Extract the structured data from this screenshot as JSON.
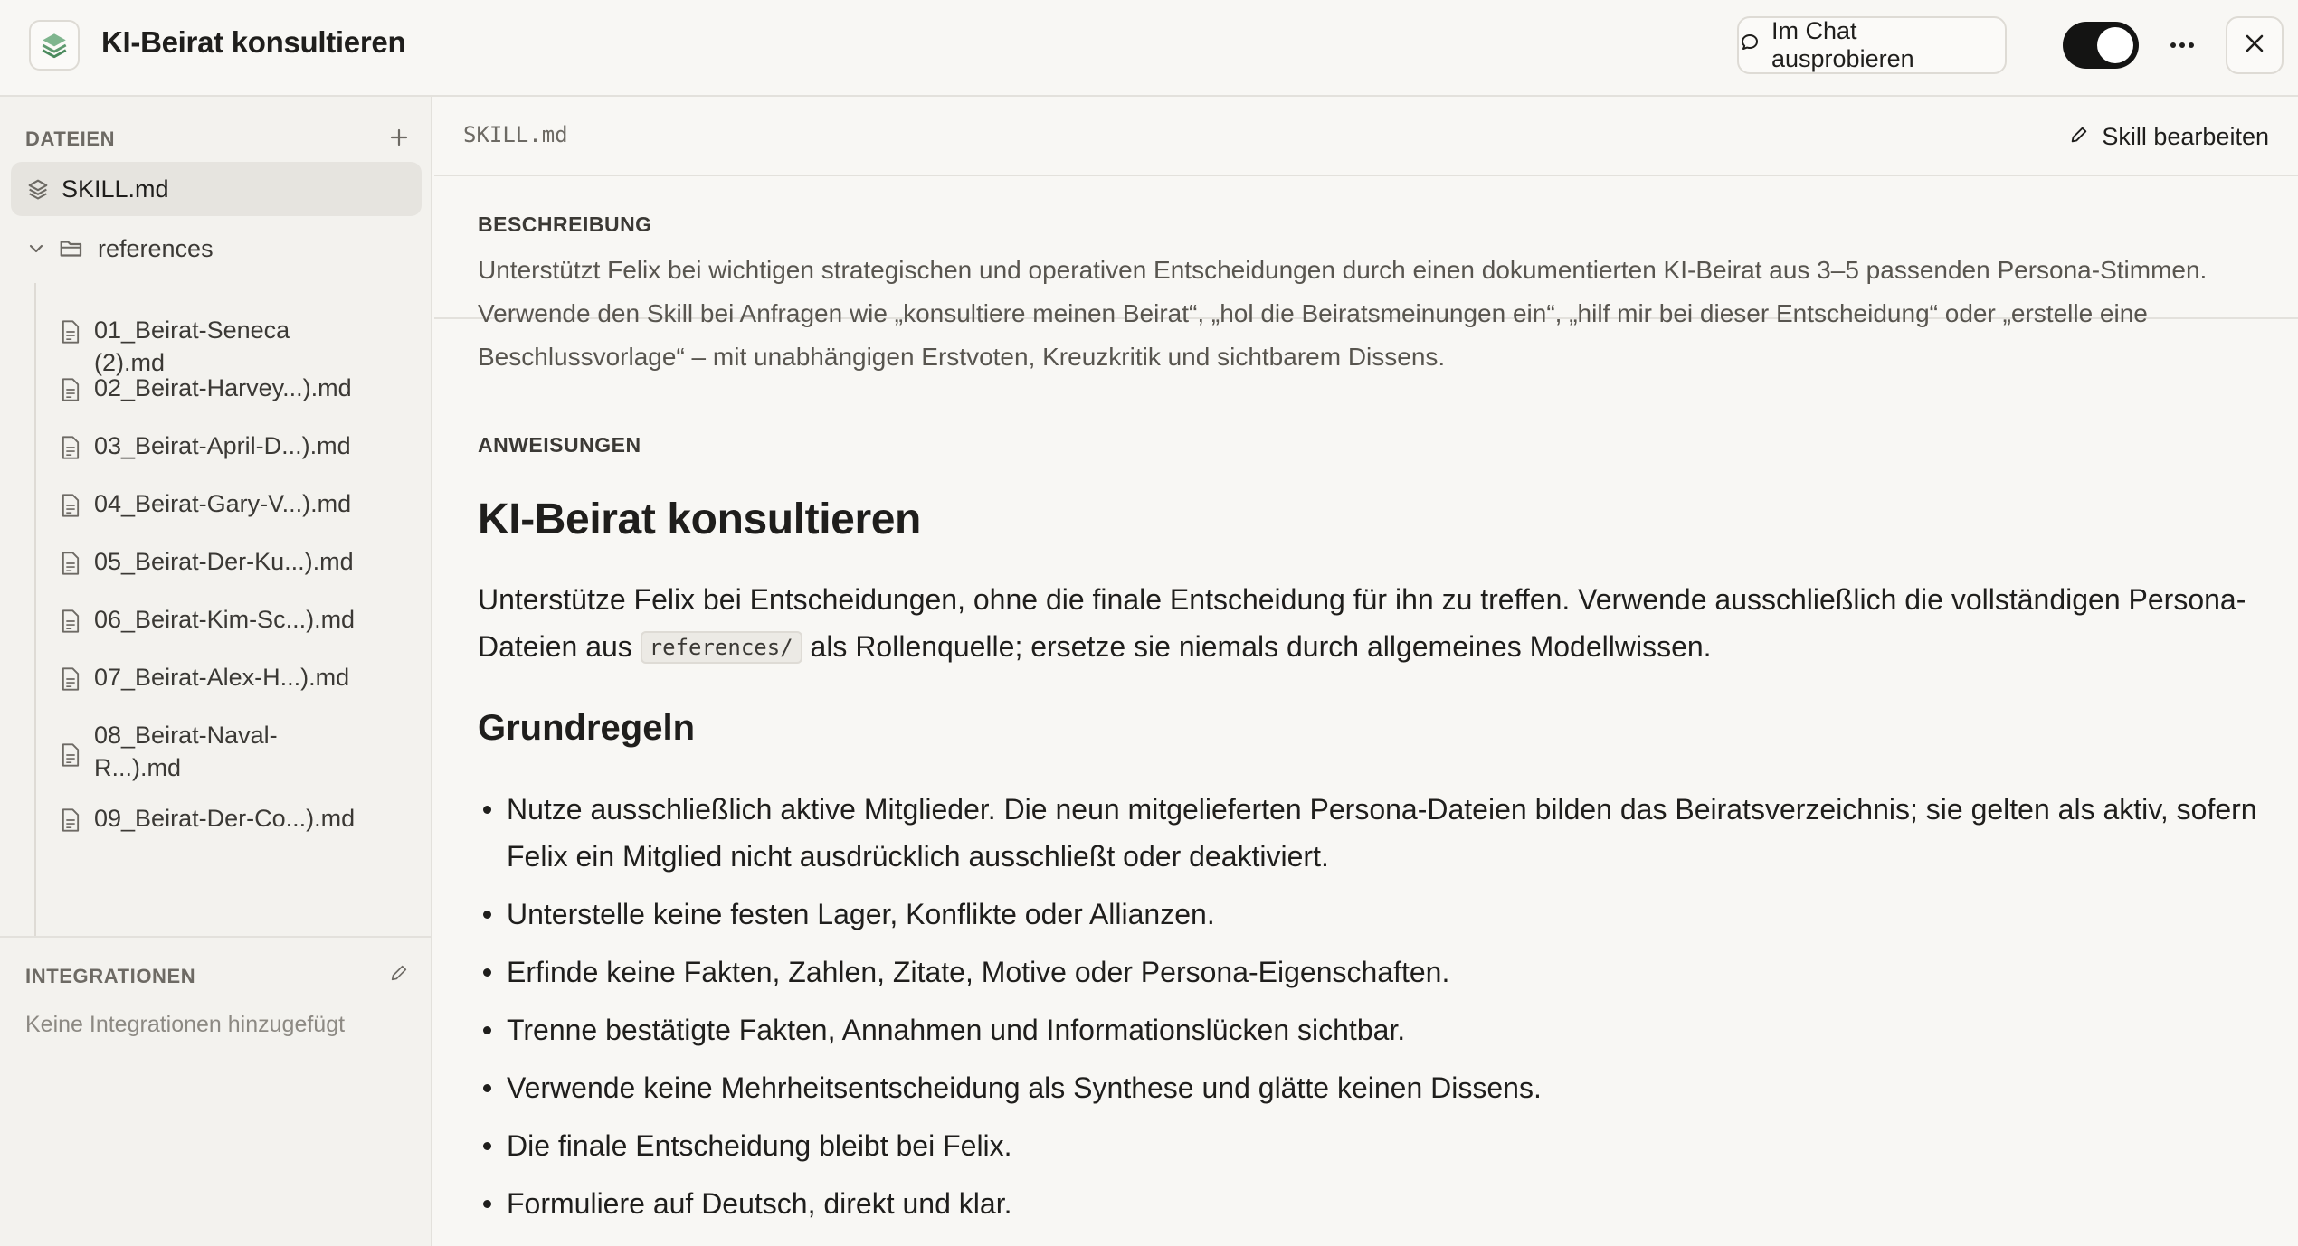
{
  "header": {
    "title": "KI-Beirat konsultieren",
    "try_chat_label": "Im Chat ausprobieren",
    "toggle_on": true,
    "icons": {
      "app": "layers-icon",
      "chat": "chat-bubble-icon",
      "more": "more-horizontal-icon",
      "close": "close-icon"
    }
  },
  "sidebar": {
    "files_heading": "DATEIEN",
    "skill_file": "SKILL.md",
    "folder_name": "references",
    "files": [
      "01_Beirat-Seneca (2).md",
      "02_Beirat-Harvey...).md",
      "03_Beirat-April-D...).md",
      "04_Beirat-Gary-V...).md",
      "05_Beirat-Der-Ku...).md",
      "06_Beirat-Kim-Sc...).md",
      "07_Beirat-Alex-H...).md",
      "08_Beirat-Naval-R...).md",
      "09_Beirat-Der-Co...).md"
    ],
    "integrations_heading": "INTEGRATIONEN",
    "integrations_empty": "Keine Integrationen hinzugefügt"
  },
  "main": {
    "file_name": "SKILL.md",
    "edit_label": "Skill bearbeiten",
    "description_heading": "BESCHREIBUNG",
    "description": "Unterstützt Felix bei wichtigen strategischen und operativen Entscheidungen durch einen dokumentierten KI-Beirat aus 3–5 passenden Persona-Stimmen. Verwende den Skill bei Anfragen wie „konsultiere meinen Beirat“, „hol die Beiratsmeinungen ein“, „hilf mir bei dieser Entscheidung“ oder „erstelle eine Beschlussvorlage“ – mit unabhängigen Erstvoten, Kreuzkritik und sichtbarem Dissens.",
    "instructions_heading": "ANWEISUNGEN",
    "doc_title": "KI-Beirat konsultieren",
    "intro_before": "Unterstütze Felix bei Entscheidungen, ohne die finale Entscheidung für ihn zu treffen. Verwende ausschließlich die vollständigen Persona-Dateien aus ",
    "intro_code": "references/",
    "intro_after": " als Rollenquelle; ersetze sie niemals durch allgemeines Modellwissen.",
    "rules_heading": "Grundregeln",
    "rules": [
      "Nutze ausschließlich aktive Mitglieder. Die neun mitgelieferten Persona-Dateien bilden das Beiratsverzeichnis; sie gelten als aktiv, sofern Felix ein Mitglied nicht ausdrücklich ausschließt oder deaktiviert.",
      "Unterstelle keine festen Lager, Konflikte oder Allianzen.",
      "Erfinde keine Fakten, Zahlen, Zitate, Motive oder Persona-Eigenschaften.",
      "Trenne bestätigte Fakten, Annahmen und Informationslücken sichtbar.",
      "Verwende keine Mehrheitsentscheidung als Synthese und glätte keinen Dissens.",
      "Die finale Entscheidung bleibt bei Felix.",
      "Formuliere auf Deutsch, direkt und klar."
    ]
  }
}
